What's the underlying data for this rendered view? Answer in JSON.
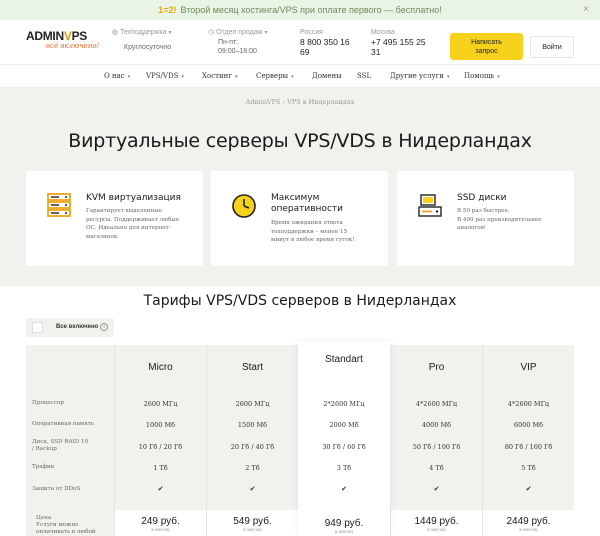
{
  "promo": {
    "highlight": "1=2!",
    "text": "Второй месяц хостинга/VPS при оплате первого — бесплатно!",
    "close": "×"
  },
  "header": {
    "logo_text_a": "ADMIN",
    "logo_text_v": "V",
    "logo_text_b": "PS",
    "slogan": "всё включено!",
    "support_label": "Техподдержка",
    "support_value": "Круглосуточно",
    "sales_label": "Отдел продаж",
    "sales_value": "Пн-пт:",
    "sales_hours": "09:00–18:00",
    "region1_label": "Россия",
    "region1_phone_a": "8 800 350 16",
    "region1_phone_b": "69",
    "region2_label": "Москва",
    "region2_phone_a": "+7 495 155 25",
    "region2_phone_b": "31",
    "write_btn_a": "Написать",
    "write_btn_b": "запрос",
    "login_btn": "Войти"
  },
  "nav": {
    "items": [
      "О нас",
      "VPS/VDS",
      "Хостинг",
      "Серверы",
      "Домены",
      "SSL",
      "Другие услуги",
      "Помощь"
    ]
  },
  "hero": {
    "breadcrumbs": "AdminVPS › VPS в Нидерландах",
    "title": "Виртуальные серверы VPS/VDS в Нидерландах",
    "features": [
      {
        "title_a": "KVM виртуализация",
        "title_b": "",
        "desc": [
          "Гарантирует выделенные",
          "ресурсы. Поддерживает любые",
          "ОС. Идеально для интернет-",
          "магазинов."
        ],
        "icon": "server-icon"
      },
      {
        "title_a": "Максимум",
        "title_b": "оперативности",
        "desc": [
          "Время ожидания ответа",
          "техподдержки – менее 15",
          "минут в любое время суток!"
        ],
        "icon": "clock-icon"
      },
      {
        "title_a": "SSD диски",
        "title_b": "",
        "desc": [
          "В 50 раз быстрее.",
          "В 400 раз производительнее",
          "аналогов!"
        ],
        "icon": "ssd-icon"
      }
    ]
  },
  "tariffs": {
    "title": "Тарифы VPS/VDS серверов в Нидерландах",
    "switch_label": "Все включено",
    "switch_info": "i",
    "row_labels": {
      "cpu": "Процессор",
      "ram": "Оперативная память",
      "disk_a": "Диск, SSD RAID 10",
      "disk_b": "/ Backup",
      "traffic": "Трафик",
      "ddos": "Защита от DDoS",
      "price_a": "Цена",
      "price_b": "Услуги можно",
      "price_c": "оплачивать в любой"
    },
    "plans": [
      {
        "name": "Micro",
        "cpu": "2600 МГц",
        "ram": "1000 Мб",
        "disk": "10 Гб / 20 Гб",
        "traffic": "1 Тб",
        "ddos": "✔",
        "price": "249 руб.",
        "per": "в месяц"
      },
      {
        "name": "Start",
        "cpu": "2600 МГц",
        "ram": "1500 Мб",
        "disk": "20 Гб / 40 Гб",
        "traffic": "2 Тб",
        "ddos": "✔",
        "price": "549 руб.",
        "per": "в месяц"
      },
      {
        "name": "Standart",
        "cpu": "2*2600 МГц",
        "ram": "2000 Мб",
        "disk": "30 Гб / 60 Гб",
        "traffic": "3 Тб",
        "ddos": "✔",
        "price": "949 руб.",
        "per": "в месяц"
      },
      {
        "name": "Pro",
        "cpu": "4*2600 МГц",
        "ram": "4000 Мб",
        "disk": "50 Гб / 100 Гб",
        "traffic": "4 Тб",
        "ddos": "✔",
        "price": "1449 руб.",
        "per": "в месяц"
      },
      {
        "name": "VIP",
        "cpu": "4*2600 МГц",
        "ram": "6000 Мб",
        "disk": "80 Гб / 160 Гб",
        "traffic": "5 Тб",
        "ddos": "✔",
        "price": "2449 руб.",
        "per": "в месяц"
      }
    ]
  },
  "colors": {
    "accent": "#f7d21c",
    "brand_orange": "#e89b00",
    "promo_bg": "#eaf4e4",
    "hero_bg": "#f2f1ee"
  }
}
